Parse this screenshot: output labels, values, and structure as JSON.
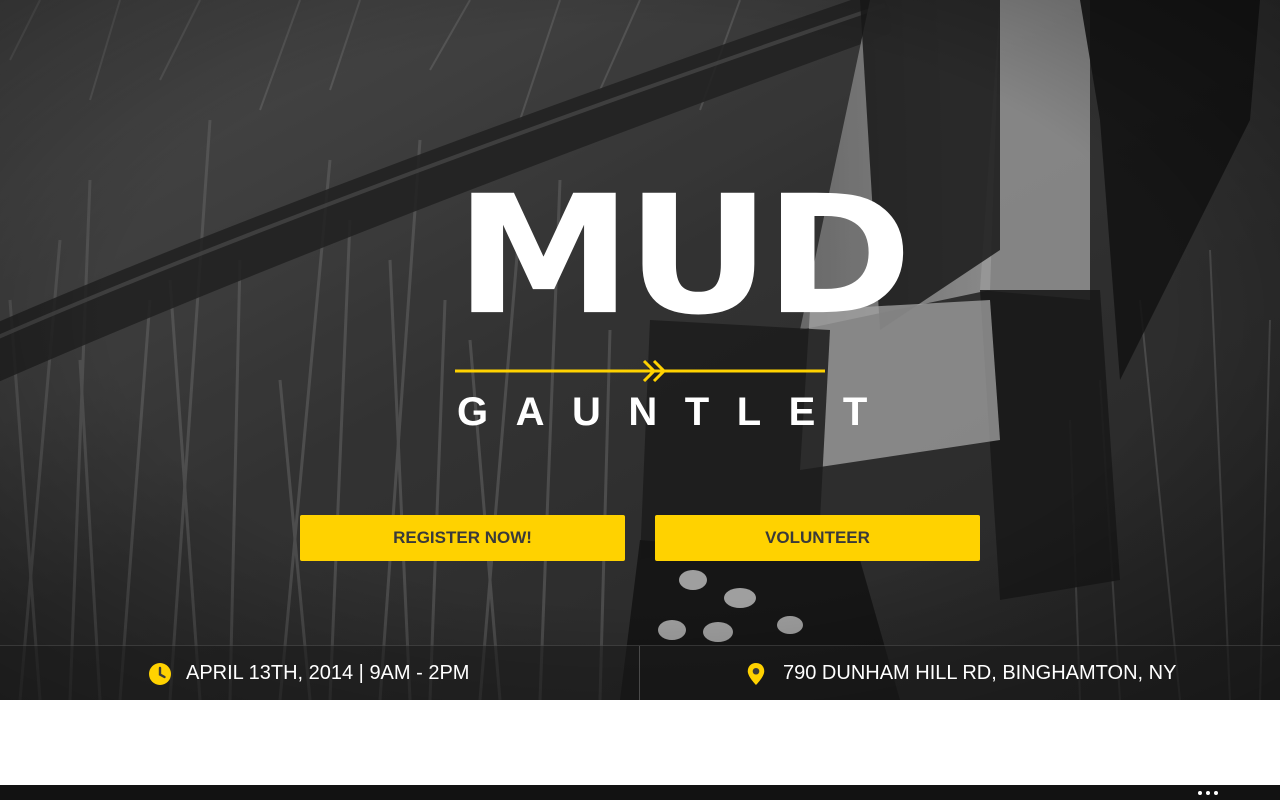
{
  "logo": {
    "primary": "MUD",
    "secondary": "GAUNTLET"
  },
  "buttons": {
    "register_label": "REGISTER NOW!",
    "volunteer_label": "VOLUNTEER"
  },
  "event": {
    "date_time": "APRIL 13TH, 2014 | 9AM - 2PM",
    "location": "790 DUNHAM HILL RD, BINGHAMTON, NY"
  },
  "icons": {
    "date": "clock-icon",
    "location": "map-pin-icon",
    "logo_divider": "double-chevron-right-icon",
    "footer_menu": "more-dots-icon"
  },
  "colors": {
    "accent": "#ffd200",
    "button_text": "#3a3a3a",
    "hero_text": "#ffffff",
    "info_bar": "#1c1c1c",
    "footer": "#121212"
  }
}
